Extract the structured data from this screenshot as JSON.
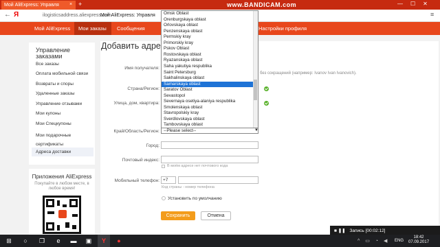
{
  "browser": {
    "tab_title": "Мой AliExpress: Управля",
    "tab_close": "×",
    "new_tab": "+",
    "url_domain": "ilogisticsaddress.aliexpress.com",
    "page_title": "Мой AliExpress: Управля"
  },
  "watermark": "www.BANDICAM.com",
  "nav": {
    "items": [
      "Мой AliExpress",
      "Мои заказы",
      "Сообщения"
    ],
    "right_item": "Настройки профиля"
  },
  "sidebar": {
    "title": "Управление заказами",
    "items": [
      "Все заказы",
      "Оплата мобильной связи",
      "Возвраты и споры",
      "Удаленные заказы",
      "Управление отзывами",
      "Мои купоны",
      "Мои Спецкупоны",
      "Мои подарочные сертификаты",
      "Адреса доставки"
    ]
  },
  "app_promo": {
    "title": "Приложения AliExpress",
    "subtitle": "Покупайте в любом месте, в любое время!"
  },
  "form": {
    "heading": "Добавить адрес",
    "name_label": "Имя получателя:",
    "name_hint": "без сокращений (например: Ivanov Ivan Ivanovich).",
    "country_label": "Страна/Регион:",
    "street_label": "Улица, дом, квартира:",
    "region_label": "Край/Область/Регион:",
    "region_value": "--Please select--",
    "city_label": "Город:",
    "zip_label": "Почтовый индекс:",
    "zip_checkbox": "В моём адресе нет почтового кода",
    "phone_label": "Мобильный телефон:",
    "phone_code": "+7",
    "phone_hint": "Код страны - номер телефона",
    "default_label": "Установить по умолчанию",
    "save": "Сохранить",
    "cancel": "Отмена"
  },
  "dropdown": {
    "options": [
      "Omsk Oblast",
      "Orenburgskaya oblast",
      "Orlovskaya oblast",
      "Penzenskaya oblast",
      "Permskiy kray",
      "Primorskiy kray",
      "Pskov Oblast",
      "Rostovskaya oblast",
      "Ryazanskaya oblast",
      "Saha yakutiya respublika",
      "Saint Petersburg",
      "Sakhalinskaya oblast",
      "Samarskaya oblast",
      "Saratov Oblast",
      "Sevastopol",
      "Severnaya osetiya-alaniya respublika",
      "Smolenskaya oblast",
      "Stavropolskiy kray",
      "Sverdlovskaya oblast",
      "Tambovskaya oblast"
    ],
    "selected": "Samarskaya oblast"
  },
  "recording": "Запись [00:02:12]",
  "taskbar": {
    "lang": "ENG",
    "time": "18:42",
    "date": "07.09.2017"
  },
  "colors": {
    "nav": "#e8471c",
    "tabbar": "#c62a10",
    "selected_option": "#1e73d6",
    "save_button": "#f39c1b",
    "check": "#5ab22c"
  }
}
